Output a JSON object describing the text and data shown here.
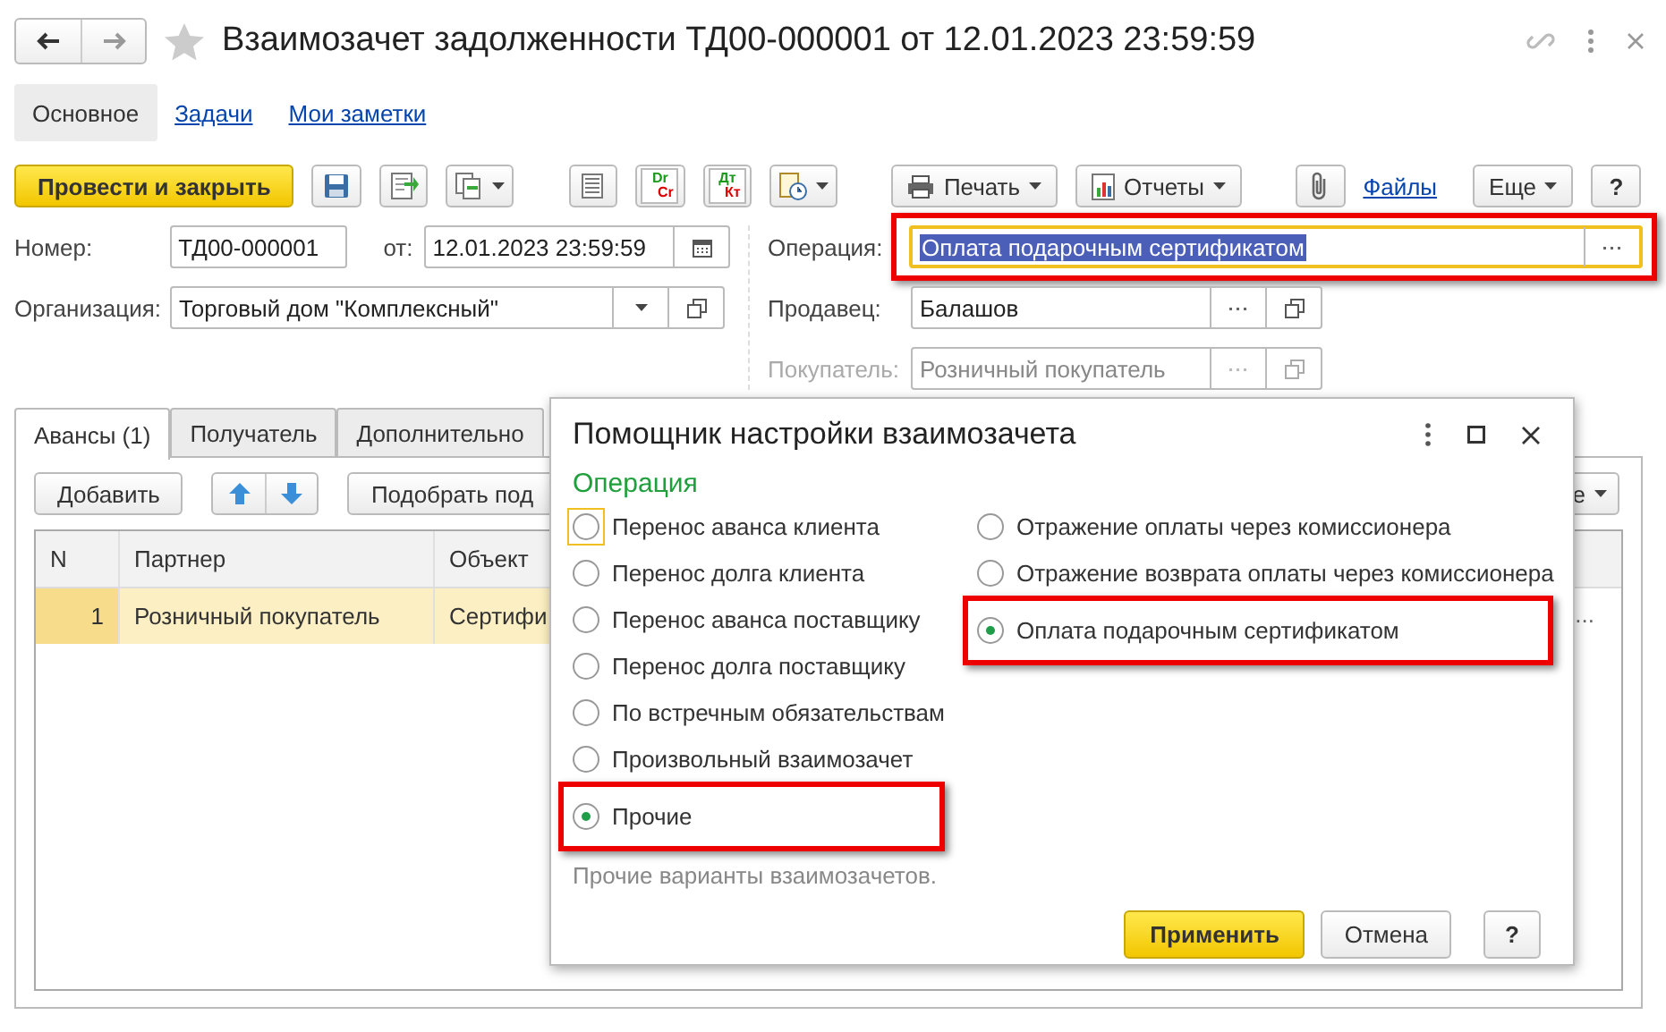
{
  "window": {
    "title": "Взаимозачет задолженности ТД00-000001 от 12.01.2023 23:59:59",
    "favorite": false
  },
  "nav_tabs": [
    {
      "label": "Основное",
      "selected": true
    },
    {
      "label": "Задачи",
      "selected": false
    },
    {
      "label": "Мои заметки",
      "selected": false
    }
  ],
  "toolbar": {
    "primary": "Провести и закрыть",
    "dr_cr": [
      "Dr",
      "Cr"
    ],
    "dt_kt": [
      "Дт",
      "Кт"
    ],
    "print": "Печать",
    "reports": "Отчеты",
    "files": "Файлы",
    "more": "Еще",
    "help": "?"
  },
  "form": {
    "number": {
      "label": "Номер:",
      "value": "ТД00-000001"
    },
    "date": {
      "label": "от:",
      "value": "12.01.2023 23:59:59"
    },
    "organization": {
      "label": "Организация:",
      "value": "Торговый дом \"Комплексный\""
    },
    "operation": {
      "label": "Операция:",
      "value": "Оплата подарочным сертификатом",
      "highlighted": true,
      "text_selected": true
    },
    "seller": {
      "label": "Продавец:",
      "value": "Балашов"
    },
    "buyer": {
      "label": "Покупатель:",
      "value": "Розничный покупатель",
      "disabled": true
    }
  },
  "tabs": [
    {
      "label": "Авансы (1)",
      "selected": true
    },
    {
      "label": "Получатель",
      "selected": false
    },
    {
      "label": "Дополнительно",
      "selected": false
    }
  ],
  "table_toolbar": {
    "add": "Добавить",
    "pick": "Подобрать под",
    "more": "е"
  },
  "table": {
    "columns": [
      "N",
      "Партнер",
      "Объект"
    ],
    "rows": [
      {
        "cells": [
          "1",
          "Розничный покупатель",
          "Сертифи"
        ],
        "trailing": "...",
        "selected": true
      }
    ]
  },
  "dialog": {
    "title": "Помощник настройки взаимозачета",
    "section": "Операция",
    "option_columns": [
      [
        {
          "label": "Перенос аванса клиента",
          "selected": false,
          "focused": true,
          "highlighted": false
        },
        {
          "label": "Перенос долга клиента",
          "selected": false,
          "focused": false,
          "highlighted": false
        },
        {
          "label": "Перенос аванса поставщику",
          "selected": false,
          "focused": false,
          "highlighted": false
        },
        {
          "label": "Перенос долга поставщику",
          "selected": false,
          "focused": false,
          "highlighted": false
        },
        {
          "label": "По встречным обязательствам",
          "selected": false,
          "focused": false,
          "highlighted": false
        },
        {
          "label": "Произвольный взаимозачет",
          "selected": false,
          "focused": false,
          "highlighted": false
        },
        {
          "label": "Прочие",
          "selected": true,
          "focused": false,
          "highlighted": true
        }
      ],
      [
        {
          "label": "Отражение оплаты через комиссионера",
          "selected": false,
          "focused": false,
          "highlighted": false
        },
        {
          "label": "Отражение возврата оплаты через комиссионера",
          "selected": false,
          "focused": false,
          "highlighted": false
        },
        {
          "label": "Оплата подарочным сертификатом",
          "selected": true,
          "focused": false,
          "highlighted": true
        }
      ]
    ],
    "hint": "Прочие варианты взаимозачетов.",
    "buttons": [
      {
        "label": "Применить",
        "kind": "primary"
      },
      {
        "label": "Отмена",
        "kind": "default"
      },
      {
        "label": "?",
        "kind": "default"
      }
    ]
  }
}
